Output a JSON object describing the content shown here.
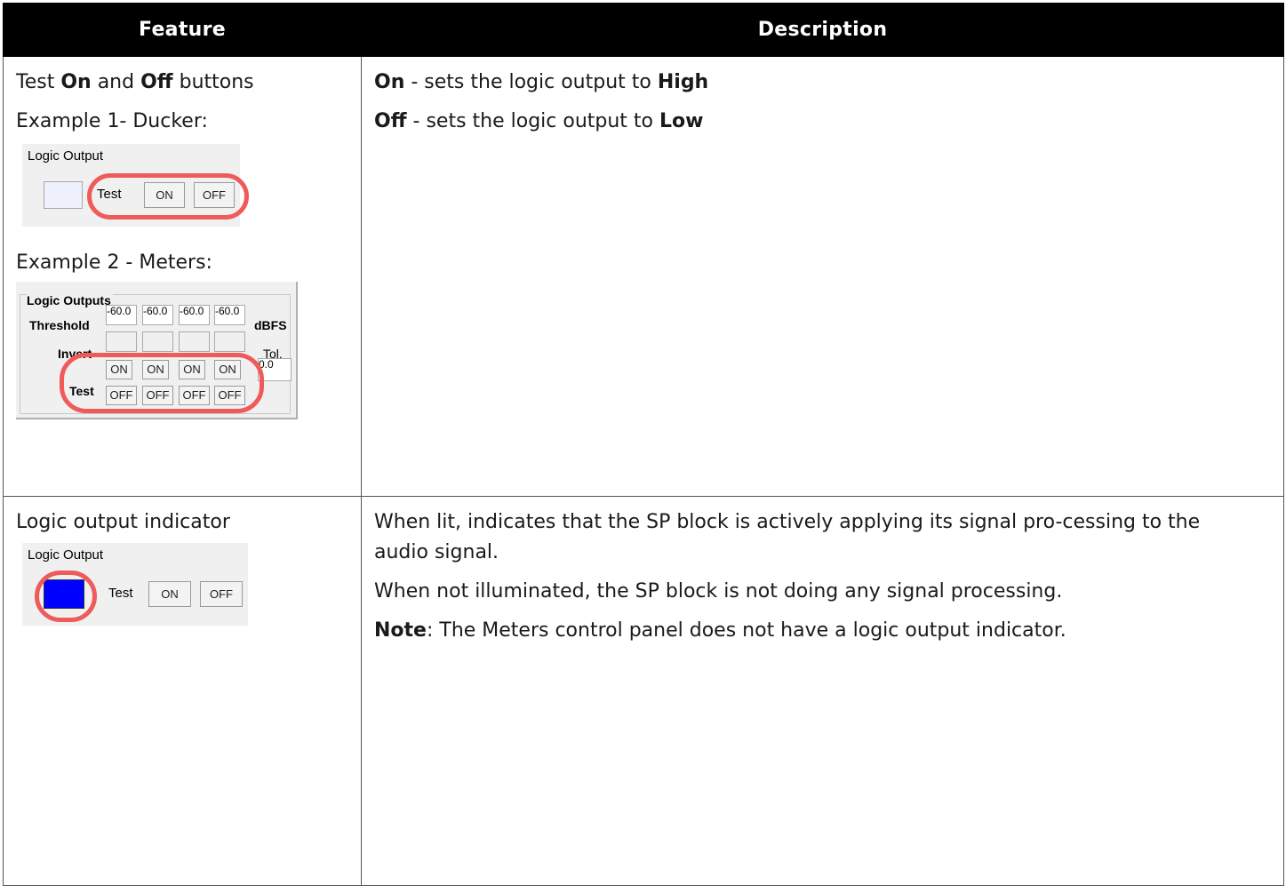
{
  "header": {
    "feature": "Feature",
    "description": "Description"
  },
  "row1": {
    "feature_pre": "Test ",
    "feature_on": "On",
    "feature_mid": " and ",
    "feature_off": "Off",
    "feature_post": " buttons",
    "example1": "Example 1- Ducker:",
    "example2": "Example 2 - Meters:",
    "desc_on_label": "On",
    "desc_on_text": " - sets the logic output to ",
    "desc_on_value": "High",
    "desc_off_label": "Off",
    "desc_off_text": " - sets the logic output to ",
    "desc_off_value": "Low"
  },
  "ducker_panel": {
    "title": "Logic Output",
    "test": "Test",
    "on": "ON",
    "off": "OFF"
  },
  "meters_panel": {
    "title": "Logic Outputs",
    "threshold": "Threshold",
    "threshold_values": [
      "-60.0",
      "-60.0",
      "-60.0",
      "-60.0"
    ],
    "unit": "dBFS",
    "invert": "Invert",
    "tol": "Tol.",
    "tol_value": "0.0",
    "test": "Test",
    "on": "ON",
    "off": "OFF"
  },
  "row2": {
    "feature": "Logic output indicator",
    "desc1": "When lit, indicates that the SP block is actively applying its signal pro-cessing to the audio signal.",
    "desc2": "When not illuminated, the SP block is not doing any signal processing.",
    "note_label": "Note",
    "note_text": ": The Meters control panel does not have a logic output indicator."
  },
  "indicator_panel": {
    "title": "Logic Output",
    "test": "Test",
    "on": "ON",
    "off": "OFF",
    "lit_color": "#0000ff"
  },
  "colors": {
    "header_bg": "#000000",
    "highlight_ring": "#ef5a5a"
  }
}
